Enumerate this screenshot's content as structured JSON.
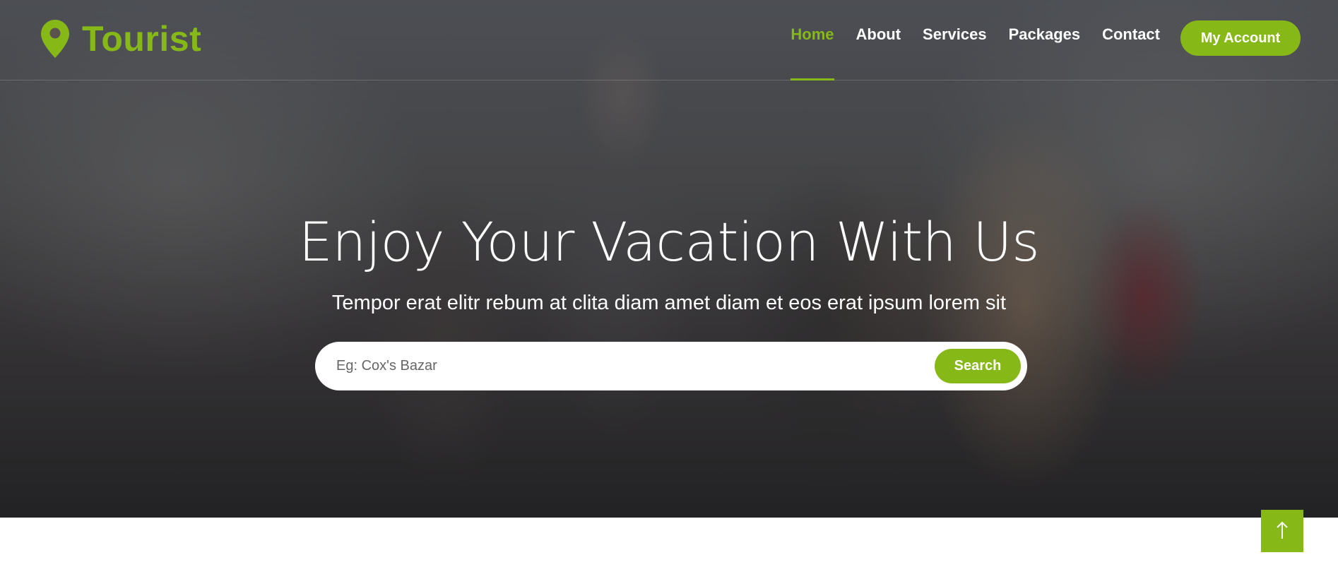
{
  "brand": {
    "name": "Tourist",
    "icon": "map-marker-icon"
  },
  "nav": {
    "items": [
      {
        "label": "Home",
        "active": true
      },
      {
        "label": "About",
        "active": false
      },
      {
        "label": "Services",
        "active": false
      },
      {
        "label": "Packages",
        "active": false
      },
      {
        "label": "Contact",
        "active": false
      }
    ],
    "account_label": "My Account"
  },
  "hero": {
    "title": "Enjoy Your Vacation With Us",
    "subtitle": "Tempor erat elitr rebum at clita diam amet diam et eos erat ipsum lorem sit",
    "search": {
      "placeholder": "Eg: Cox's Bazar",
      "button_label": "Search"
    }
  },
  "back_to_top": {
    "icon": "arrow-up-icon"
  },
  "colors": {
    "accent": "#86b817",
    "text_light": "#ffffff"
  }
}
